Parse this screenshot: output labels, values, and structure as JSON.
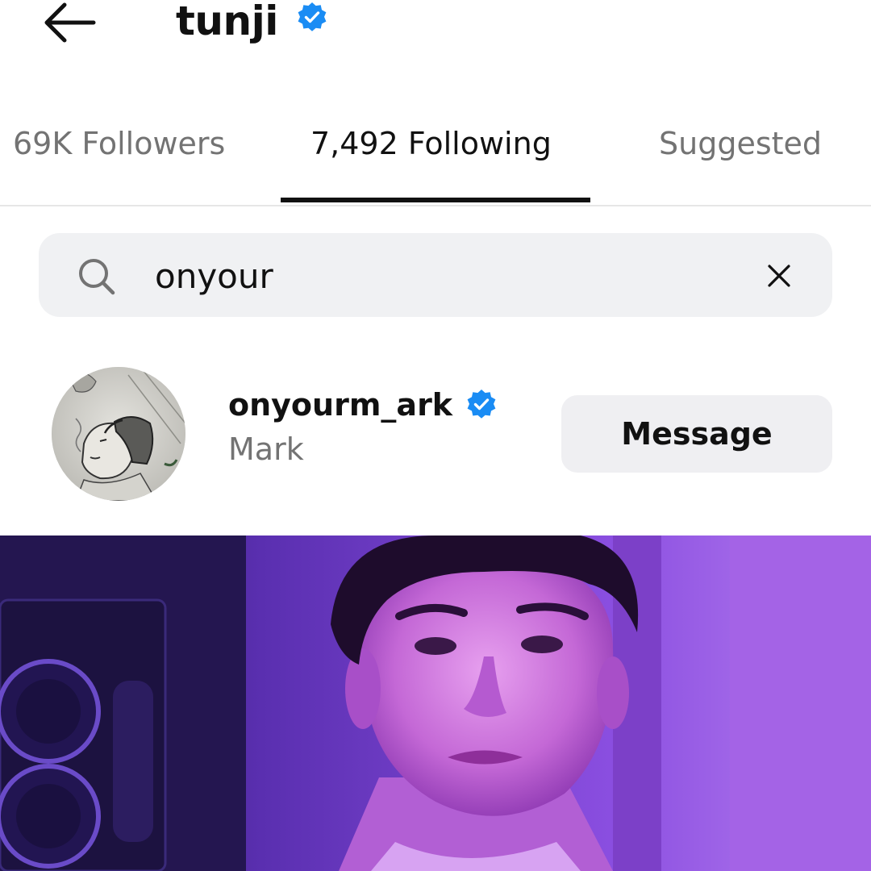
{
  "header": {
    "title": "tunji",
    "verified_icon": "verified-badge-icon",
    "back_icon": "arrow-left-icon"
  },
  "tabs": [
    {
      "label": "69K Followers",
      "active": false
    },
    {
      "label": "7,492 Following",
      "active": true
    },
    {
      "label": "Suggested",
      "active": false
    }
  ],
  "search": {
    "value": "onyour",
    "icon": "search-icon",
    "clear_icon": "close-icon"
  },
  "results": [
    {
      "username": "onyourm_ark",
      "full_name": "Mark",
      "verified": true,
      "action_label": "Message"
    }
  ],
  "colors": {
    "verified_blue": "#1a8cf4",
    "secondary_text": "#737373",
    "search_bg": "#f0f1f3",
    "button_bg": "#efeff2",
    "photo_tint": "#8a2be2"
  }
}
